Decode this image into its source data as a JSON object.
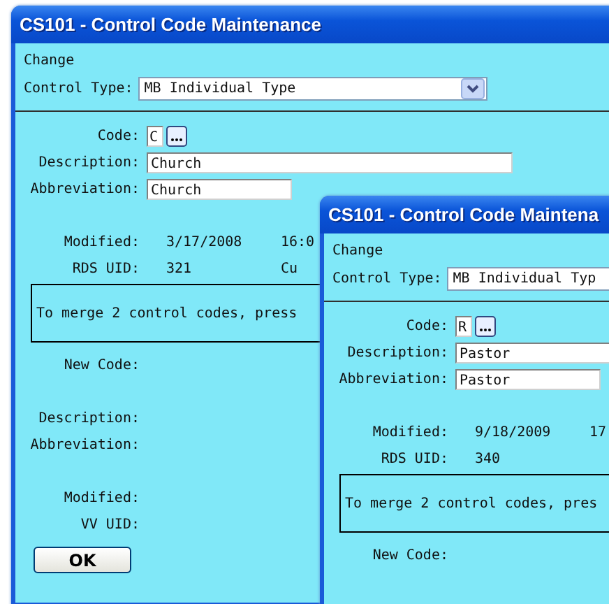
{
  "windows": [
    {
      "title": "CS101 - Control Code Maintenance",
      "mode": "Change",
      "control_type": {
        "label": "Control Type:",
        "value": "MB Individual Type"
      },
      "code": {
        "label": "Code:",
        "value": "C"
      },
      "fields": [
        {
          "label": "Description:",
          "value": "Church"
        },
        {
          "label": "Abbreviation:",
          "value": "Church"
        }
      ],
      "info": [
        {
          "label": "Modified:",
          "values": [
            "3/17/2008",
            "16:0"
          ]
        },
        {
          "label": "RDS UID:",
          "values": [
            "321",
            "Cu"
          ]
        }
      ],
      "merge_message": "To merge 2 control codes, press",
      "merge_fields": [
        [
          "New Code:"
        ],
        [
          "Description:",
          "Abbreviation:"
        ],
        [
          "Modified:",
          "VV UID:"
        ]
      ],
      "ok_button": "OK"
    },
    {
      "title": "CS101 - Control Code Maintena",
      "mode": "Change",
      "control_type": {
        "label": "Control Type:",
        "value": "MB Individual Typ"
      },
      "code": {
        "label": "Code:",
        "value": "R"
      },
      "fields": [
        {
          "label": "Description:",
          "value": "Pastor"
        },
        {
          "label": "Abbreviation:",
          "value": "Pastor"
        }
      ],
      "info": [
        {
          "label": "Modified:",
          "values": [
            "9/18/2009",
            "17"
          ]
        },
        {
          "label": "RDS UID:",
          "values": [
            "340"
          ]
        }
      ],
      "merge_message": "To merge 2 control codes, pres",
      "merge_fields": [
        [
          "New Code:"
        ]
      ]
    }
  ]
}
